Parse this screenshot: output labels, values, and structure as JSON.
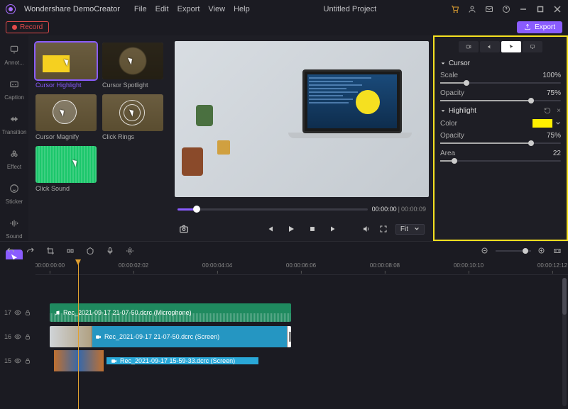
{
  "app": {
    "name": "Wondershare DemoCreator",
    "project": "Untitled Project"
  },
  "menu": {
    "file": "File",
    "edit": "Edit",
    "export": "Export",
    "view": "View",
    "help": "Help"
  },
  "topbar": {
    "record": "Record",
    "export": "Export"
  },
  "sidebar": {
    "annot": "Annot...",
    "caption": "Caption",
    "transition": "Transition",
    "effect": "Effect",
    "sticker": "Sticker",
    "sound": "Sound",
    "cursor": "Cursor"
  },
  "effects": {
    "highlight": "Cursor Highlight",
    "spotlight": "Cursor Spotlight",
    "magnify": "Cursor Magnify",
    "rings": "Click Rings",
    "sound": "Click Sound"
  },
  "preview": {
    "time_current": "00:00:00",
    "time_total": "00:00:09",
    "fit": "Fit"
  },
  "props": {
    "cursor_head": "Cursor",
    "scale_label": "Scale",
    "scale_val": "100%",
    "opacity_label": "Opacity",
    "opacity_val": "75%",
    "highlight_head": "Highlight",
    "color_label": "Color",
    "h_opacity_label": "Opacity",
    "h_opacity_val": "75%",
    "area_label": "Area",
    "area_val": "22"
  },
  "timeline": {
    "ticks": [
      "00:00:00:00",
      "00:00:02:02",
      "00:00:04:04",
      "00:00:06:06",
      "00:00:08:08",
      "00:00:10:10",
      "00:00:12:12"
    ],
    "track1_num": "17",
    "track2_num": "16",
    "track3_num": "15",
    "clip_audio": "Rec_2021-09-17 21-07-50.dcrc (Microphone)",
    "clip_video1": "Rec_2021-09-17 21-07-50.dcrc (Screen)",
    "clip_video2": "Rec_2021-09-17 15-59-33.dcrc (Screen)"
  }
}
